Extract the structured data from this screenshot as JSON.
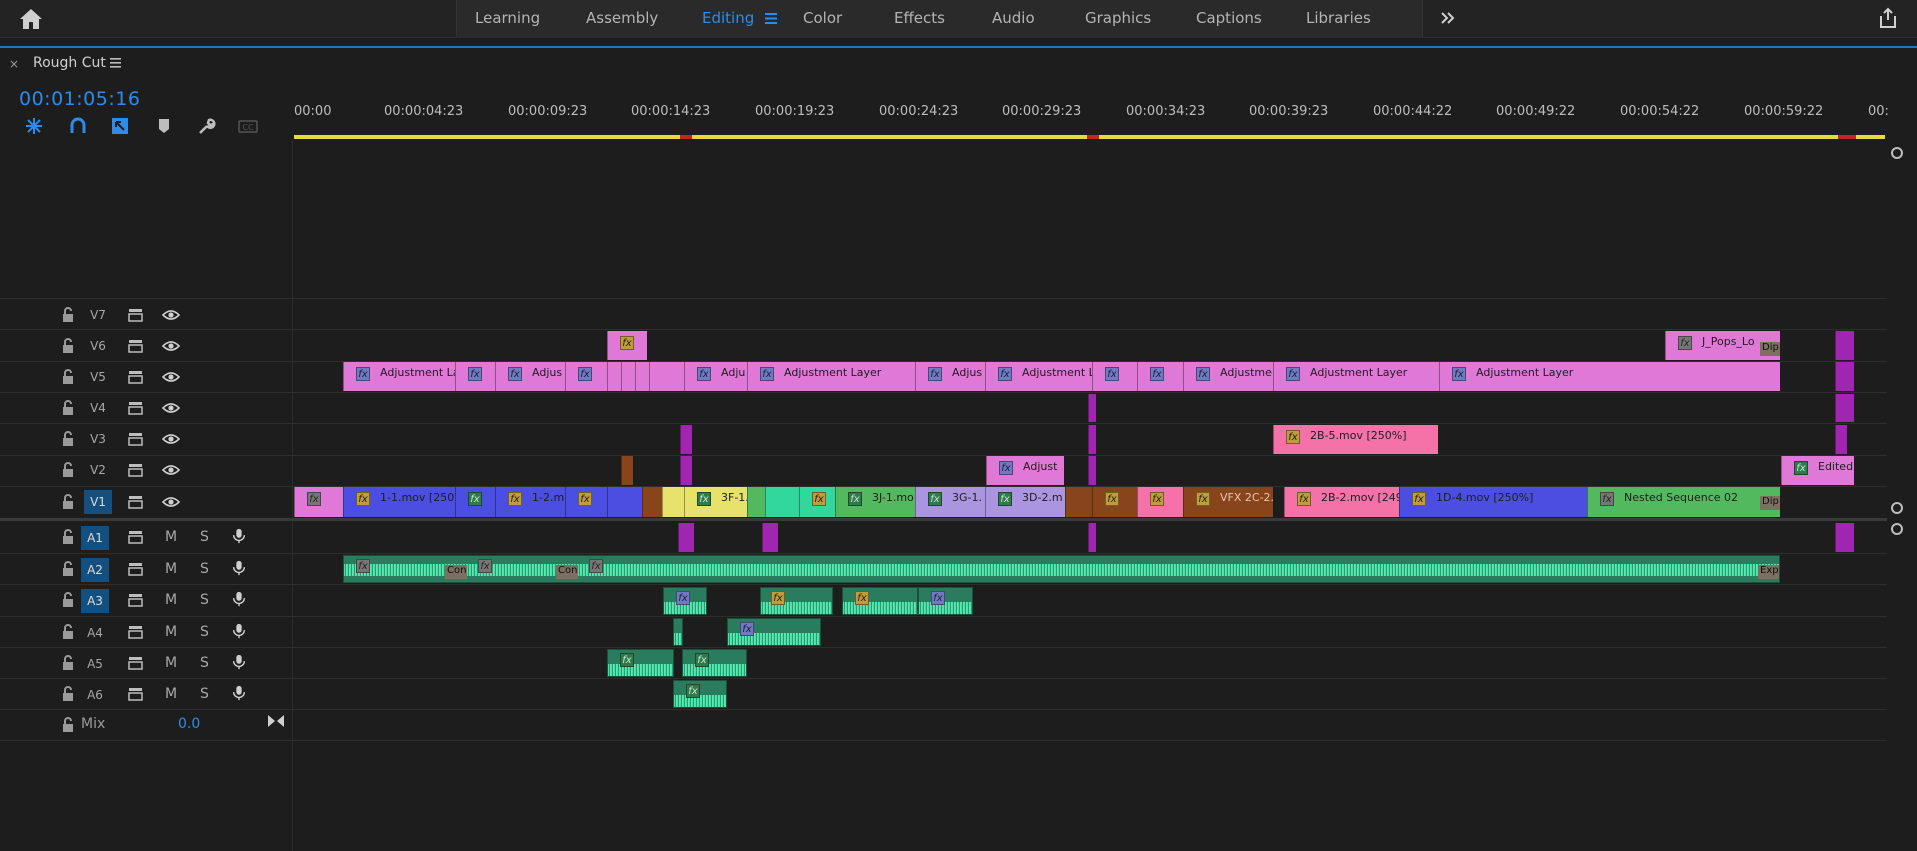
{
  "workspace_tabs": [
    {
      "label": "Learning"
    },
    {
      "label": "Assembly"
    },
    {
      "label": "Editing",
      "active": true
    },
    {
      "label": "Color"
    },
    {
      "label": "Effects"
    },
    {
      "label": "Audio"
    },
    {
      "label": "Graphics"
    },
    {
      "label": "Captions"
    },
    {
      "label": "Libraries"
    }
  ],
  "panel": {
    "close_label": "×",
    "sequence_name": "Rough Cut"
  },
  "timecode": "00:01:05:16",
  "ruler_ticks": [
    "00:00",
    "00:00:04:23",
    "00:00:09:23",
    "00:00:14:23",
    "00:00:19:23",
    "00:00:24:23",
    "00:00:29:23",
    "00:00:34:23",
    "00:00:39:23",
    "00:00:44:22",
    "00:00:49:22",
    "00:00:54:22",
    "00:00:59:22",
    "00:"
  ],
  "video_tracks": [
    "V7",
    "V6",
    "V5",
    "V4",
    "V3",
    "V2",
    "V1"
  ],
  "audio_tracks": [
    "A1",
    "A2",
    "A3",
    "A4",
    "A5",
    "A6"
  ],
  "track_buttons": {
    "mute": "M",
    "solo": "S"
  },
  "mix": {
    "label": "Mix",
    "value": "0.0"
  },
  "clip_labels": {
    "v6_a": "",
    "v6_b": "J_Pops_Lo",
    "v6_b_tr": "Dip",
    "v5_1": "Adjustment La",
    "v5_2": "",
    "v5_3": "Adjus",
    "v5_4": "",
    "v5_5": "Adju",
    "v5_6": "Adjustment Layer",
    "v5_7": "Adjus",
    "v5_8": "Adjustment L",
    "v5_9": "",
    "v5_10": "",
    "v5_11": "Adjustme",
    "v5_12": "Adjustment Layer",
    "v5_13": "Adjustment Layer",
    "v3_1": "2B-5.mov [250%]",
    "v2_1": "Adjust",
    "v2_2": "Edited",
    "v1_1": "1-1.mov [250",
    "v1_2": "",
    "v1_3": "1-2.m",
    "v1_4": "",
    "v1_5": "3F-1.",
    "v1_6": "",
    "v1_7": "3J-1.mo",
    "v1_8": "3G-1.",
    "v1_9": "3D-2.m",
    "v1_10": "",
    "v1_11": "",
    "v1_12": "VFX 2C-2.",
    "v1_13": "2B-2.mov [249",
    "v1_14": "1D-4.mov [250%]",
    "v1_15": "Nested Sequence 02",
    "v1_tr": "Dip",
    "a2_t1": "Con",
    "a2_t2": "Con",
    "a2_t3": "Exp"
  },
  "colors": {
    "accent": "#2d8ceb",
    "playhead_bar": "#e6da3c",
    "selected_track": "#135080"
  }
}
